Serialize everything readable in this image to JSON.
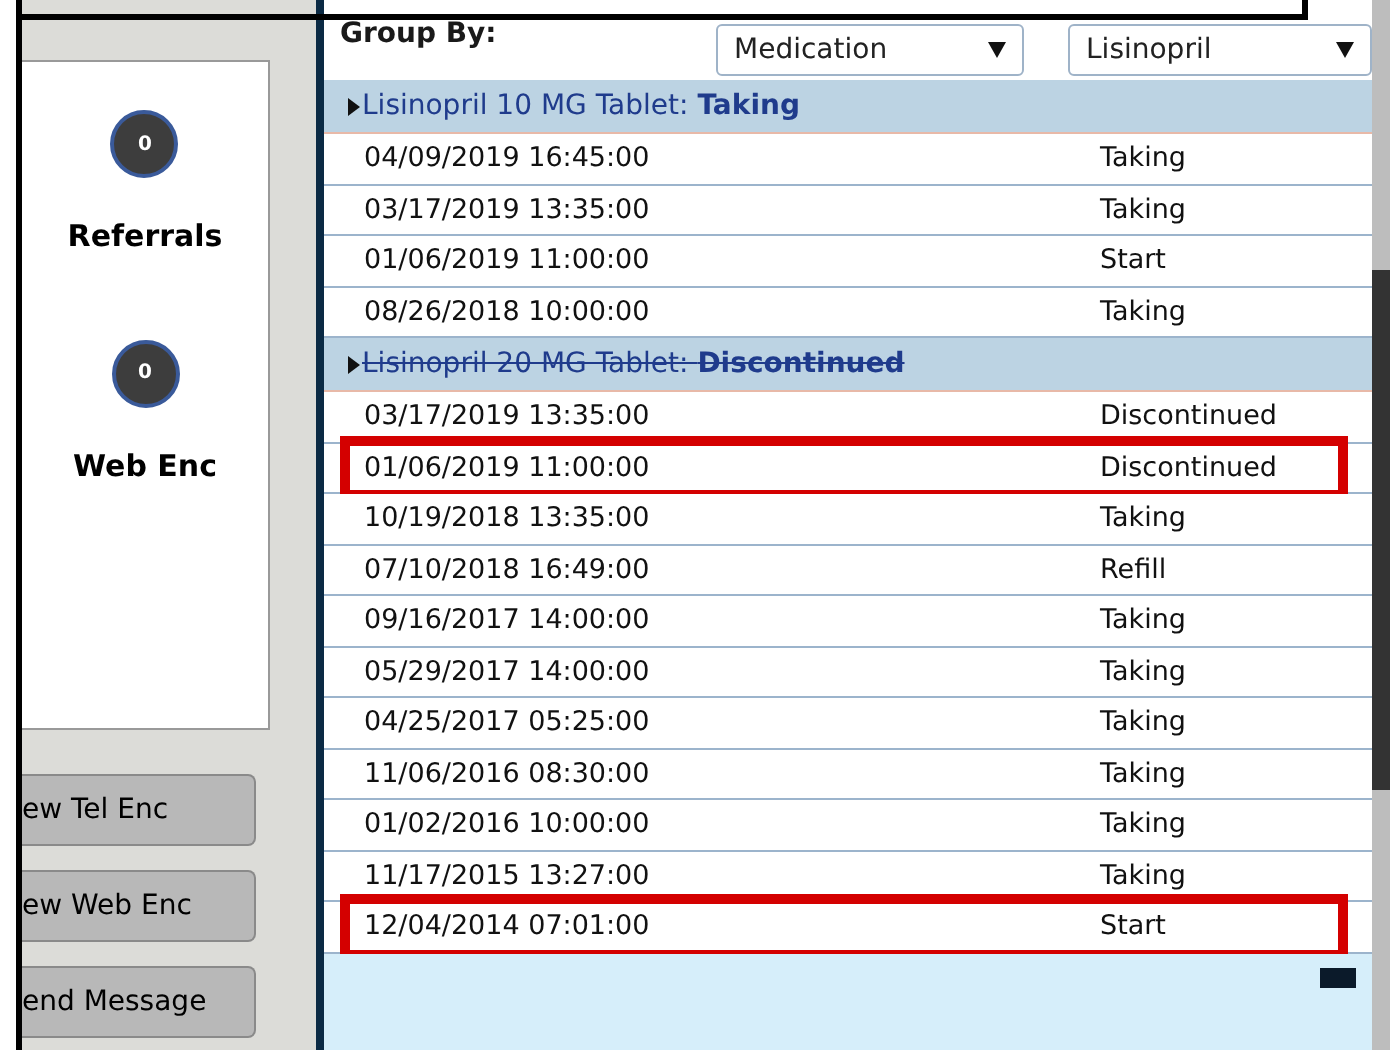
{
  "side_panel": {
    "counters": [
      {
        "count": "0",
        "label": "Referrals"
      },
      {
        "count": "0",
        "label": "Web Enc"
      }
    ],
    "buttons": [
      "ew Tel Enc",
      "ew Web Enc",
      "end Message"
    ]
  },
  "group_by": {
    "label": "Group By:",
    "selects": [
      "Medication",
      "Lisinopril"
    ]
  },
  "groups": [
    {
      "name": "Lisinopril 10 MG Tablet:",
      "status": "Taking",
      "discontinued": false,
      "rows": [
        {
          "date": "04/09/2019 16:45:00",
          "status": "Taking",
          "highlighted": false
        },
        {
          "date": "03/17/2019 13:35:00",
          "status": "Taking",
          "highlighted": false
        },
        {
          "date": "01/06/2019 11:00:00",
          "status": "Start",
          "highlighted": false
        },
        {
          "date": "08/26/2018 10:00:00",
          "status": "Taking",
          "highlighted": false
        }
      ]
    },
    {
      "name": "Lisinopril 20 MG Tablet:",
      "status": "Discontinued",
      "discontinued": true,
      "rows": [
        {
          "date": "03/17/2019 13:35:00",
          "status": "Discontinued",
          "highlighted": false
        },
        {
          "date": "01/06/2019 11:00:00",
          "status": "Discontinued",
          "highlighted": true
        },
        {
          "date": "10/19/2018 13:35:00",
          "status": "Taking",
          "highlighted": false
        },
        {
          "date": "07/10/2018 16:49:00",
          "status": "Refill",
          "highlighted": false
        },
        {
          "date": "09/16/2017 14:00:00",
          "status": "Taking",
          "highlighted": false
        },
        {
          "date": "05/29/2017 14:00:00",
          "status": "Taking",
          "highlighted": false
        },
        {
          "date": "04/25/2017 05:25:00",
          "status": "Taking",
          "highlighted": false
        },
        {
          "date": "11/06/2016 08:30:00",
          "status": "Taking",
          "highlighted": false
        },
        {
          "date": "01/02/2016 10:00:00",
          "status": "Taking",
          "highlighted": false
        },
        {
          "date": "11/17/2015 13:27:00",
          "status": "Taking",
          "highlighted": false
        },
        {
          "date": "12/04/2014 07:01:00",
          "status": "Start",
          "highlighted": true
        }
      ]
    }
  ]
}
